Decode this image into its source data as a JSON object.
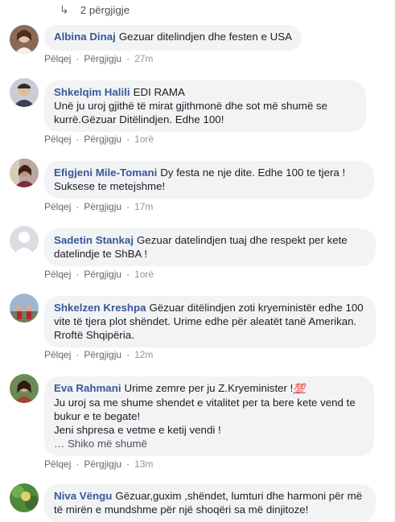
{
  "replies_link": {
    "icon": "reply-arrow-icon",
    "label": "2 përgjigje"
  },
  "actions": {
    "like": "Pëlqej",
    "reply": "Përgjigju",
    "sep": "·"
  },
  "comments": [
    {
      "author": "Albina Dinaj",
      "text": "Gezuar ditelindjen dhe festen e USA",
      "time": "27m"
    },
    {
      "author": "Shkelqim Halili",
      "text_line1": "EDI RAMA",
      "text_rest": "Unë ju uroj gjithë të mirat gjithmonë dhe sot më shumë se kurrë.Gëzuar Ditëlindjen. Edhe 100!",
      "time": "1orë"
    },
    {
      "author": "Efigjeni Mile-Tomani",
      "text": "Dy festa ne nje dite. Edhe 100 te tjera ! Suksese te metejshme!",
      "time": "17m"
    },
    {
      "author": "Sadetin Stankaj",
      "text": "Gezuar datelindjen tuaj dhe respekt per kete datelindje te ShBA !",
      "time": "1orë"
    },
    {
      "author": "Shkelzen Kreshpa",
      "text": "Gëzuar ditëlindjen zoti kryeministër edhe 100 vite të tjera plot shëndet. Urime edhe për aleatët tanë Amerikan. Rroftë Shqipëria.",
      "time": "12m"
    },
    {
      "author": "Eva Rahmani",
      "text_line1": "Urime zemre per ju Z.Kryeminister !",
      "emoji": "💯",
      "text_line2": "Ju uroj sa me shume shendet e vitalitet per ta bere kete vend te bukur e te begate!",
      "text_line3": "Jeni shpresa e vetme e ketij vendi !",
      "see_more": "… Shiko më shumë",
      "time": "13m"
    },
    {
      "author": "Niva Vëngu",
      "text": "Gëzuar,guxim ,shëndet, lumturi dhe harmoni për më të mirën e mundshme për një shoqëri sa më dinjitoze!"
    }
  ]
}
